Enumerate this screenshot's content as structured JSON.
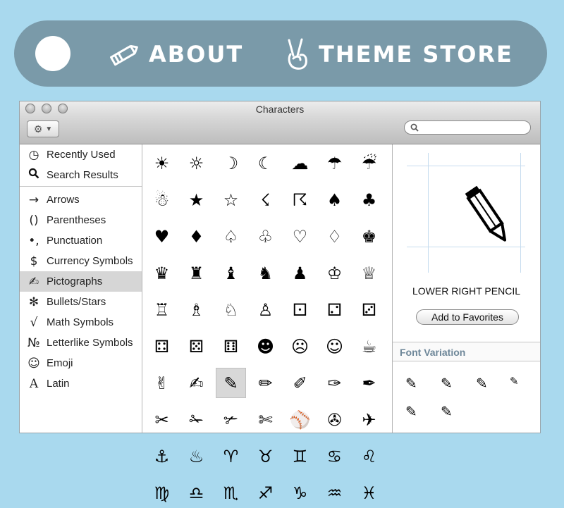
{
  "nav": {
    "about_label": "ABOUT",
    "theme_store_label": "THEME STORE"
  },
  "window": {
    "title": "Characters",
    "search_placeholder": ""
  },
  "sidebar": {
    "items": [
      {
        "icon": "◷",
        "label": "Recently Used"
      },
      {
        "icon": "🔍",
        "label": "Search Results"
      },
      {
        "icon": "→",
        "label": "Arrows"
      },
      {
        "icon": "()",
        "label": "Parentheses"
      },
      {
        "icon": "•,",
        "label": "Punctuation"
      },
      {
        "icon": "$",
        "label": "Currency Symbols"
      },
      {
        "icon": "✍",
        "label": "Pictographs"
      },
      {
        "icon": "✻",
        "label": "Bullets/Stars"
      },
      {
        "icon": "√",
        "label": "Math Symbols"
      },
      {
        "icon": "№",
        "label": "Letterlike Symbols"
      },
      {
        "icon": "☺",
        "label": "Emoji"
      },
      {
        "icon": "A",
        "label": "Latin"
      }
    ],
    "selected_index": 6
  },
  "grid": {
    "rows": [
      [
        "☀",
        "☼",
        "☽",
        "☾",
        "☁",
        "☂",
        "☔"
      ],
      [
        "☃",
        "★",
        "☆",
        "☇",
        "☈",
        "♠",
        "♣"
      ],
      [
        "♥",
        "♦",
        "♤",
        "♧",
        "♡",
        "♢",
        "♚"
      ],
      [
        "♛",
        "♜",
        "♝",
        "♞",
        "♟",
        "♔",
        "♕"
      ],
      [
        "♖",
        "♗",
        "♘",
        "♙",
        "⚀",
        "⚁",
        "⚂"
      ],
      [
        "⚃",
        "⚄",
        "⚅",
        "☻",
        "☹",
        "☺",
        "☕"
      ],
      [
        "✌",
        "✍",
        "✎",
        "✏",
        "✐",
        "✑",
        "✒"
      ],
      [
        "✂",
        "✁",
        "✃",
        "✄",
        "⚾",
        "✇",
        "✈"
      ],
      [
        "⚓",
        "♨",
        "♈",
        "♉",
        "♊",
        "♋",
        "♌"
      ],
      [
        "♍",
        "♎",
        "♏",
        "♐",
        "♑",
        "♒",
        "♓"
      ]
    ],
    "selected_row": 6,
    "selected_col": 2
  },
  "preview": {
    "glyph": "✎",
    "name": "LOWER RIGHT PENCIL",
    "favorites_label": "Add to Favorites"
  },
  "font_variation": {
    "heading": "Font Variation",
    "glyphs": [
      "✎",
      "✎",
      "✎",
      "✎",
      "✎",
      "✎"
    ]
  }
}
